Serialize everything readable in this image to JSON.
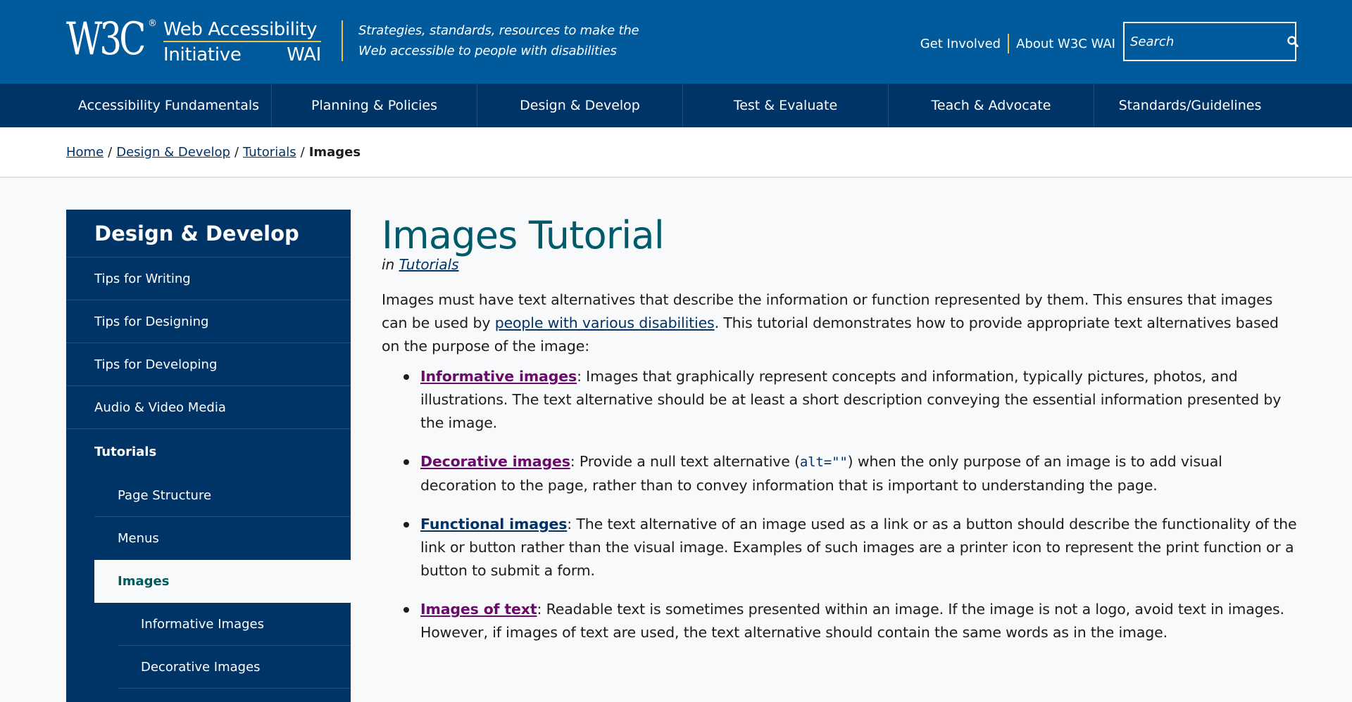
{
  "header": {
    "logo_w3c": "W3C",
    "logo_reg": "®",
    "logo_line1": "Web Accessibility",
    "logo_line2a": "Initiative",
    "logo_line2b": "WAI",
    "tagline": "Strategies, standards, resources to make the Web accessible to people with disabilities",
    "links": [
      "Get Involved",
      "About W3C WAI"
    ],
    "search_placeholder": "Search",
    "search_icon": "magnifier-icon"
  },
  "mainnav": [
    "Accessibility Fundamentals",
    "Planning & Policies",
    "Design & Develop",
    "Test & Evaluate",
    "Teach & Advocate",
    "Standards/Guidelines"
  ],
  "breadcrumb": {
    "items": [
      "Home",
      "Design & Develop",
      "Tutorials"
    ],
    "current": "Images"
  },
  "sidebar": {
    "title": "Design & Develop",
    "items": [
      {
        "label": "Tips for Writing"
      },
      {
        "label": "Tips for Designing"
      },
      {
        "label": "Tips for Developing"
      },
      {
        "label": "Audio & Video Media"
      },
      {
        "label": "Tutorials"
      },
      {
        "label": "Page Structure"
      },
      {
        "label": "Menus"
      },
      {
        "label": "Images"
      },
      {
        "label": "Informative Images"
      },
      {
        "label": "Decorative Images"
      }
    ]
  },
  "main": {
    "title": "Images Tutorial",
    "in_prefix": "in",
    "in_link": "Tutorials",
    "intro_1": "Images must have text alternatives that describe the information or function represented by them. This ensures that images can be used by ",
    "intro_link": "people with various disabilities",
    "intro_2": ". This tutorial demonstrates how to provide appropriate text alternatives based on the purpose of the image:",
    "types": [
      {
        "link": "Informative images",
        "text": ": Images that graphically represent concepts and information, typically pictures, photos, and illustrations. The text alternative should be at least a short description conveying the essential information presented by the image."
      },
      {
        "link": "Decorative images",
        "text_a": ": Provide a null text alternative (",
        "code": "alt=\"\"",
        "text_b": ") when the only purpose of an image is to add visual decoration to the page, rather than to convey information that is important to understanding the page."
      },
      {
        "link": "Functional images",
        "text": ": The text alternative of an image used as a link or as a button should describe the functionality of the link or button rather than the visual image. Examples of such images are a printer icon to represent the print function or a button to submit a form."
      },
      {
        "link": "Images of text",
        "text": ": Readable text is sometimes presented within an image. If the image is not a logo, avoid text in images. However, if images of text are used, the text alternative should contain the same words as in the image."
      }
    ]
  },
  "colors": {
    "header_blue": "#005a9c",
    "nav_navy": "#003366",
    "accent_gold": "#f3c546",
    "title_teal": "#005a6a",
    "visited_purple": "#6a0a6a"
  }
}
